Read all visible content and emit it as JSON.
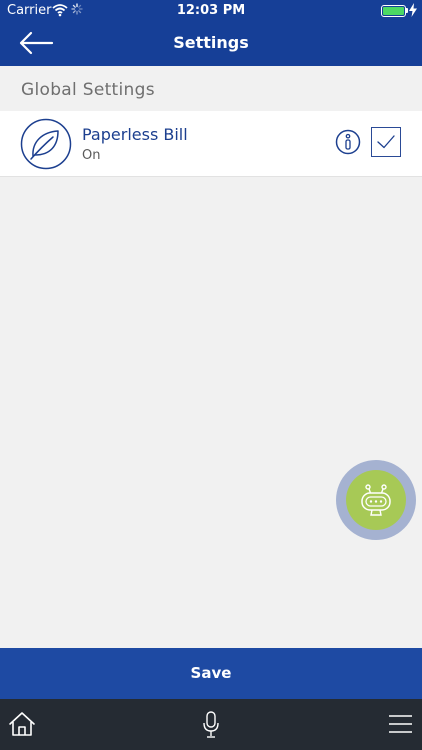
{
  "status_bar": {
    "carrier": "Carrier",
    "time": "12:03 PM",
    "battery_level": 1.0
  },
  "nav": {
    "title": "Settings",
    "back_icon": "arrow-left-icon"
  },
  "section": {
    "title": "Global Settings"
  },
  "settings": [
    {
      "icon": "leaf-icon",
      "title": "Paperless Bill",
      "status": "On",
      "checked": true,
      "info_icon": "info-icon"
    }
  ],
  "fab": {
    "icon": "robot-icon"
  },
  "save": {
    "label": "Save"
  },
  "toolbar": {
    "icons": [
      "home-icon",
      "microphone-icon",
      "menu-icon"
    ]
  },
  "colors": {
    "header": "#163f97",
    "save_bar": "#1e4aa3",
    "toolbar": "#252b33",
    "accent_text": "#1c3f8f",
    "fab_outer": "#a5b2d1",
    "fab_inner": "#a7c956",
    "background": "#f1f1f1"
  }
}
